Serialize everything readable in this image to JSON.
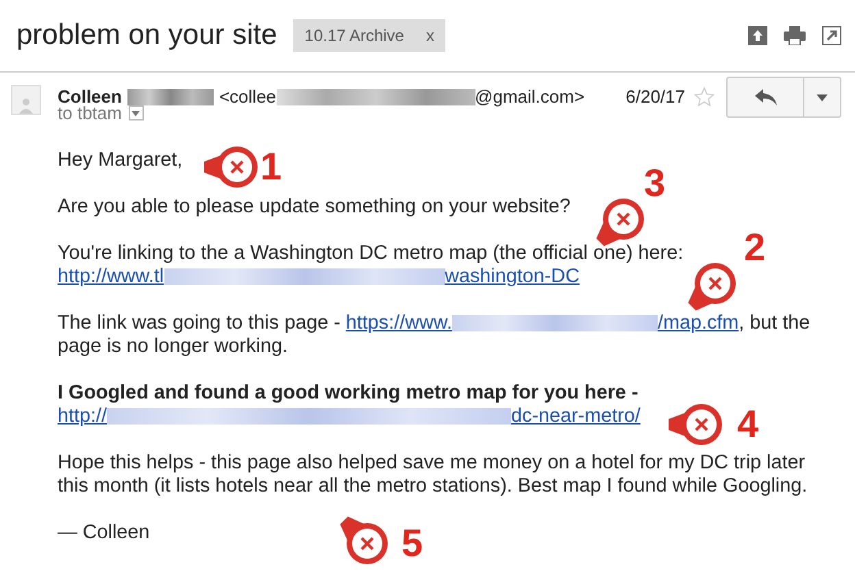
{
  "subject": "problem on your site",
  "label": {
    "text": "10.17 Archive",
    "close": "x"
  },
  "sender": {
    "name": "Colleen",
    "email_start": "<collee",
    "email_end": "@gmail.com>",
    "date": "6/20/17",
    "starred": false,
    "to": "to tbtam"
  },
  "body": [
    {
      "kind": "text",
      "text": "Hey Margaret,"
    },
    {
      "kind": "text",
      "text": "Are you able to please update something on your website?"
    },
    {
      "kind": "text_link",
      "text": "You're linking to the a Washington DC metro map (the official one) here:",
      "link_start": "http://www.tl",
      "link_end": "washington-DC"
    },
    {
      "kind": "inline_link",
      "text": "The link was going to this page - ",
      "link_start": "https://www.",
      "link_end": "/map.cfm",
      "after": ", but the page is no longer working."
    },
    {
      "kind": "bold_link",
      "text": "I Googled and found a good working metro map for you here -",
      "link_start": "http://",
      "link_end": "dc-near-metro/"
    },
    {
      "kind": "text",
      "text": "Hope this helps - this page also helped save me money on a hotel for my DC trip later this month (it lists hotels near all the metro stations). Best map I found while Googling."
    },
    {
      "kind": "text",
      "text": "— Colleen"
    }
  ],
  "markers": [
    {
      "label": "1"
    },
    {
      "label": "3"
    },
    {
      "label": "2"
    },
    {
      "label": "4"
    },
    {
      "label": "5"
    }
  ]
}
